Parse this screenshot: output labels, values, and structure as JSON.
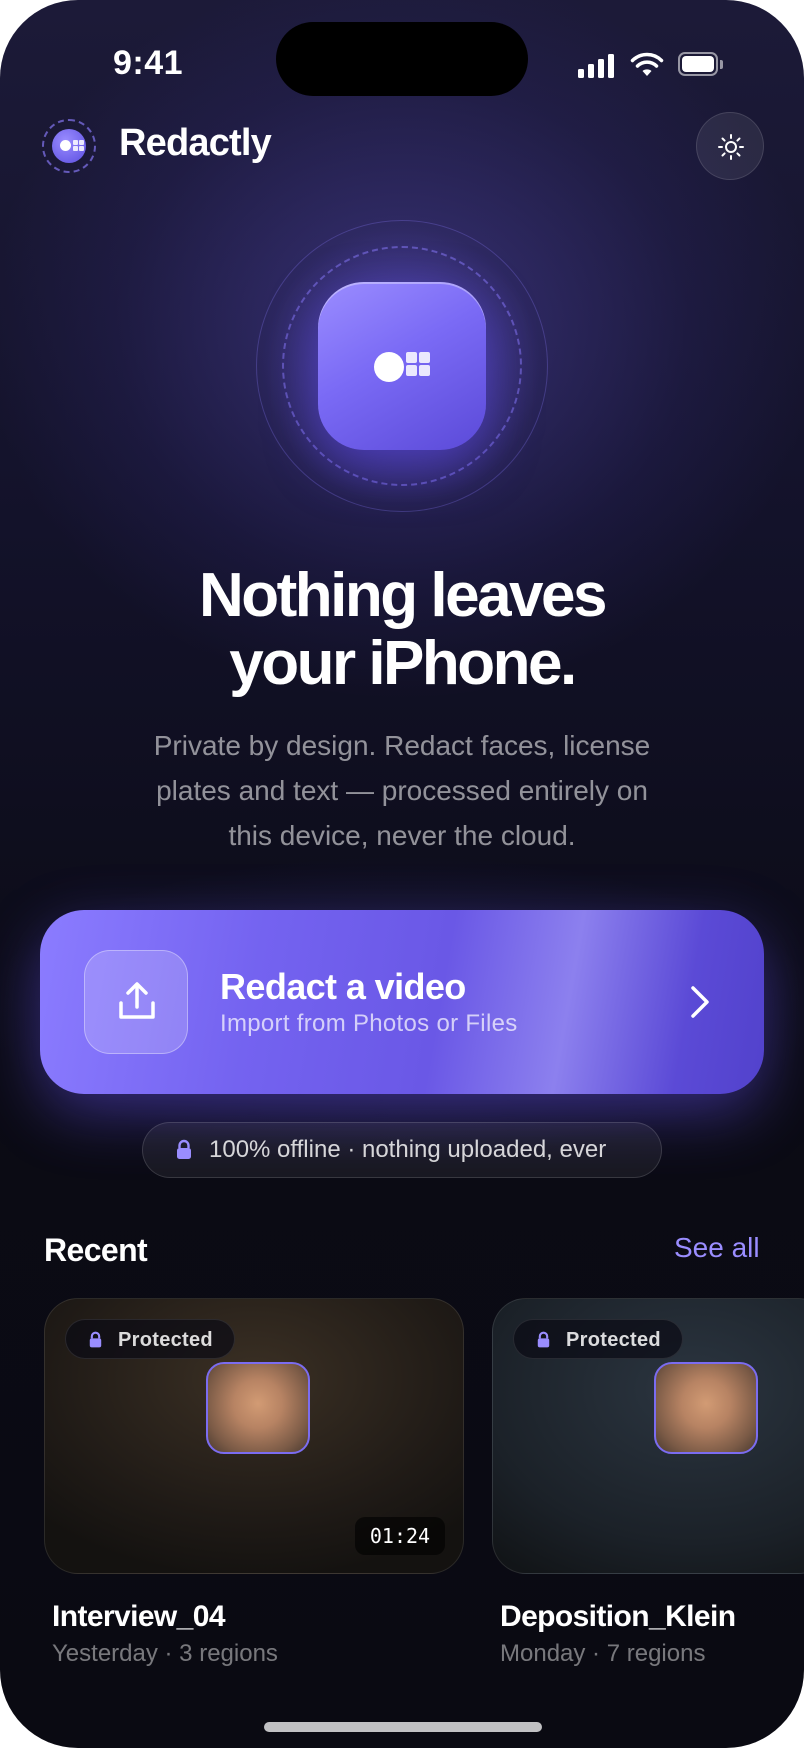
{
  "status_bar": {
    "time": "9:41"
  },
  "header": {
    "brand": "Redactly",
    "icons": [
      "redactly-logo-icon",
      "sun-icon"
    ]
  },
  "hero": {
    "headline_line1": "Nothing leaves",
    "headline_line2": "your iPhone.",
    "subtext_line1": "Private by design. Redact faces, license",
    "subtext_line2": "plates and text — processed entirely on",
    "subtext_line3": "this device, never the cloud."
  },
  "cta": {
    "title": "Redact a video",
    "subtitle": "Import from Photos or Files",
    "icon": "upload-icon"
  },
  "offline_badge": {
    "text": "100% offline · nothing uploaded, ever",
    "icon": "lock-icon"
  },
  "recent": {
    "title": "Recent",
    "see_all": "See all",
    "items": [
      {
        "badge": "Protected",
        "duration": "01:24",
        "name": "Interview_04",
        "meta": "Yesterday · 3 regions"
      },
      {
        "badge": "Protected",
        "name": "Deposition_Klein",
        "meta": "Monday · 7 regions"
      }
    ]
  },
  "colors": {
    "accent": "#7B6CF0",
    "link": "#9A8DFF",
    "background": "#0B0B15"
  }
}
